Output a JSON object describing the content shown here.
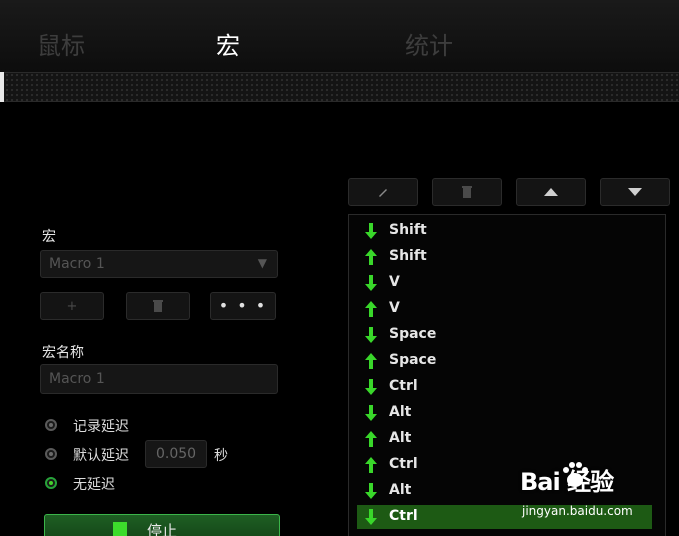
{
  "tabs": [
    {
      "label": "鼠标",
      "active": false
    },
    {
      "label": "宏",
      "active": true
    },
    {
      "label": "统计",
      "active": false
    }
  ],
  "left": {
    "macro_label": "宏",
    "macro_select_value": "Macro 1",
    "macro_name_label": "宏名称",
    "macro_name_value": "Macro 1",
    "add_label": "+",
    "more_label": "• • •",
    "delay_options": [
      {
        "label": "记录延迟",
        "selected": false
      },
      {
        "label": "默认延迟",
        "selected": false
      },
      {
        "label": "无延迟",
        "selected": true
      }
    ],
    "default_delay_value": "0.050",
    "seconds_label": "秒",
    "stop_label": "停止"
  },
  "toolbar": {
    "icons": [
      "edit-icon",
      "delete-icon",
      "move-up-icon",
      "move-down-icon"
    ]
  },
  "events": [
    {
      "direction": "down",
      "key": "Shift"
    },
    {
      "direction": "up",
      "key": "Shift"
    },
    {
      "direction": "down",
      "key": "V"
    },
    {
      "direction": "up",
      "key": "V"
    },
    {
      "direction": "down",
      "key": "Space"
    },
    {
      "direction": "up",
      "key": "Space"
    },
    {
      "direction": "down",
      "key": "Ctrl"
    },
    {
      "direction": "down",
      "key": "Alt"
    },
    {
      "direction": "up",
      "key": "Alt"
    },
    {
      "direction": "up",
      "key": "Ctrl"
    },
    {
      "direction": "down",
      "key": "Alt"
    },
    {
      "direction": "down",
      "key": "Ctrl",
      "selected": true
    }
  ],
  "watermark": {
    "brand": "Bai  经验",
    "url": "jingyan.baidu.com"
  },
  "colors": {
    "accent_green": "#3ddc2c",
    "arrow_green": "#39d72a",
    "selected_row": "#1d5a14"
  }
}
